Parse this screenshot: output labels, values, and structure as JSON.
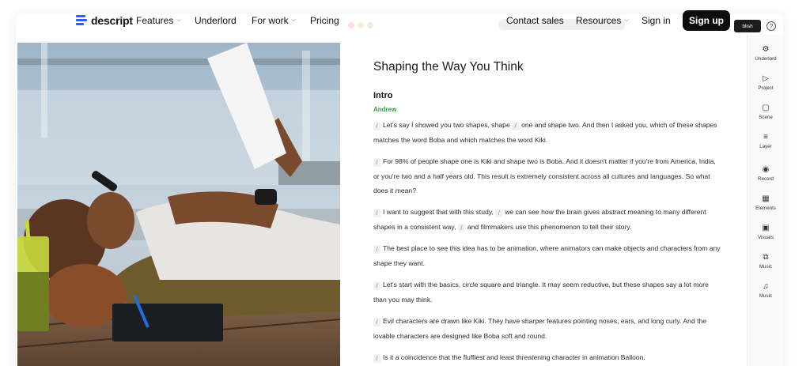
{
  "nav": {
    "logo_text": "descript",
    "items": [
      {
        "label": "Features",
        "dropdown": true
      },
      {
        "label": "Underlord",
        "dropdown": false
      },
      {
        "label": "For work",
        "dropdown": true
      },
      {
        "label": "Pricing",
        "dropdown": false
      }
    ],
    "right_items": [
      {
        "label": "Contact sales",
        "dropdown": false
      },
      {
        "label": "Resources",
        "dropdown": true
      },
      {
        "label": "Sign in",
        "dropdown": false
      }
    ],
    "signup_label": "Sign up",
    "accent_color": "#2f5bff"
  },
  "editor": {
    "doc_title": "Shaping the Way You Think",
    "section_title": "Intro",
    "speaker": "Andrew",
    "speaker_color": "#2f9e44",
    "paragraphs": [
      [
        "Let's say I showed you two shapes, shape",
        "one and shape two. And then I asked you, which of these shapes matches the word Boba and which matches the word Kiki."
      ],
      [
        "For 98% of people shape one is Kiki and shape two is Boba. And it doesn't matter if you're from America, India, or you're two and a half years old. This result is extremely consistent across all cultures and languages. So what does it mean?"
      ],
      [
        "I want to suggest that with this study,",
        "we can see how the brain gives abstract meaning to many different shapes in a consistent way,",
        "and filmmakers use this phenomenon to tell their story."
      ],
      [
        "The best place to see this idea has to be animation, where animators can make objects and characters from any shape they want."
      ],
      [
        "Let's start with the basics, circle square and triangle. It may seem reductive, but these shapes say a lot more than you may think."
      ],
      [
        "Evil characters are drawn like Kiki. They have sharper features pointing noses, ears, and long curly. And the lovable characters are designed like Boba soft and round."
      ],
      [
        "Is it a coincidence that the fluffiest and least threatening character in animation Balloon."
      ]
    ]
  },
  "rail": {
    "items": [
      {
        "label": "Underlord",
        "icon": "underlord-icon"
      },
      {
        "label": "Project",
        "icon": "play-square-icon"
      },
      {
        "label": "Scene",
        "icon": "scene-icon"
      },
      {
        "label": "Layer",
        "icon": "sliders-icon"
      },
      {
        "label": "Record",
        "icon": "record-icon"
      },
      {
        "label": "Elements",
        "icon": "elements-icon"
      },
      {
        "label": "Visuals",
        "icon": "image-icon"
      },
      {
        "label": "Music",
        "icon": "media-icon"
      },
      {
        "label": "Music",
        "icon": "music-note-icon"
      }
    ]
  },
  "publish_tip": "blish",
  "help_glyph": "?"
}
